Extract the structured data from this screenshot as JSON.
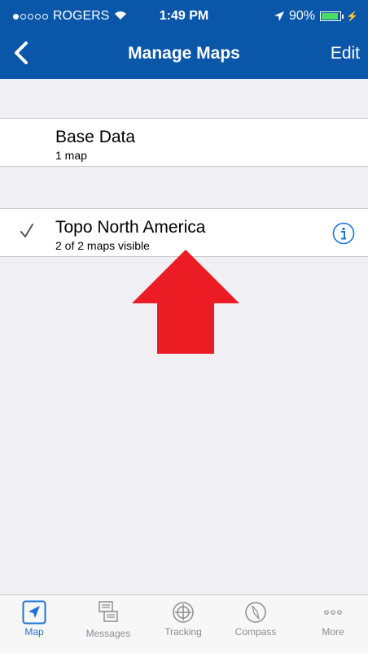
{
  "status_bar": {
    "carrier": "ROGERS",
    "time": "1:49 PM",
    "battery": "90%",
    "battery_level": 0.9
  },
  "nav": {
    "title": "Manage Maps",
    "edit_label": "Edit"
  },
  "rows": [
    {
      "name": "Base Data",
      "subtitle": "1 map"
    },
    {
      "name": "Topo North America",
      "subtitle": "2 of 2 maps visible",
      "checked": true
    }
  ],
  "tabs": [
    {
      "label": "Map",
      "icon": "map-arrow-icon",
      "active": true
    },
    {
      "label": "Messages",
      "icon": "messages-icon"
    },
    {
      "label": "Tracking",
      "icon": "tracking-icon"
    },
    {
      "label": "Compass",
      "icon": "compass-icon"
    },
    {
      "label": "More",
      "icon": "more-icon"
    }
  ],
  "colors": {
    "nav_blue": "#0a56a9",
    "active_tab": "#1b74d6",
    "arrow_red": "#ec1c24"
  }
}
